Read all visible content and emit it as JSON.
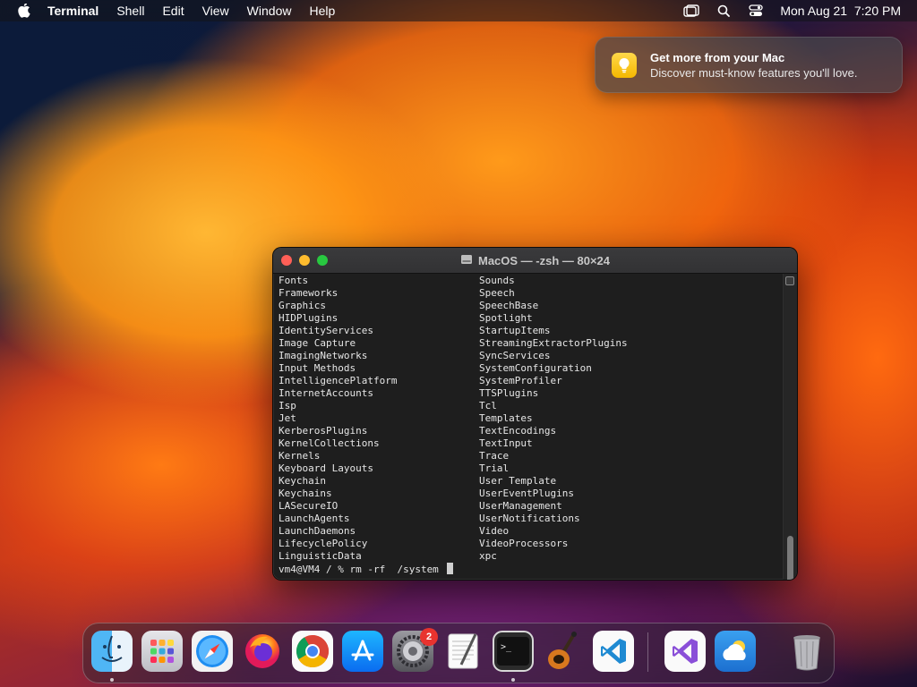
{
  "menubar": {
    "app_name": "Terminal",
    "items": [
      "Shell",
      "Edit",
      "View",
      "Window",
      "Help"
    ],
    "datetime": "Mon Aug 21  7:20 PM"
  },
  "notification": {
    "title": "Get more from your Mac",
    "body": "Discover must-know features you'll love."
  },
  "terminal": {
    "title": "MacOS — -zsh — 80×24",
    "left_column": [
      "Fonts",
      "Frameworks",
      "Graphics",
      "HIDPlugins",
      "IdentityServices",
      "Image Capture",
      "ImagingNetworks",
      "Input Methods",
      "IntelligencePlatform",
      "InternetAccounts",
      "Isp",
      "Jet",
      "KerberosPlugins",
      "KernelCollections",
      "Kernels",
      "Keyboard Layouts",
      "Keychain",
      "Keychains",
      "LASecureIO",
      "LaunchAgents",
      "LaunchDaemons",
      "LifecyclePolicy",
      "LinguisticData"
    ],
    "right_column": [
      "Sounds",
      "Speech",
      "SpeechBase",
      "Spotlight",
      "StartupItems",
      "StreamingExtractorPlugins",
      "SyncServices",
      "SystemConfiguration",
      "SystemProfiler",
      "TTSPlugins",
      "Tcl",
      "Templates",
      "TextEncodings",
      "TextInput",
      "Trace",
      "Trial",
      "User Template",
      "UserEventPlugins",
      "UserManagement",
      "UserNotifications",
      "Video",
      "VideoProcessors",
      "xpc"
    ],
    "prompt": "vm4@VM4 / % rm -rf  /system "
  },
  "dock": {
    "apps": [
      "finder-icon",
      "launchpad-icon",
      "safari-icon",
      "firefox-icon",
      "chrome-icon",
      "app-store-icon",
      "system-settings-icon",
      "textedit-icon",
      "terminal-icon",
      "garageband-icon",
      "vscode-icon",
      "visual-studio-icon",
      "weather-icon",
      "trash-icon"
    ],
    "system_settings_badge": "2"
  }
}
